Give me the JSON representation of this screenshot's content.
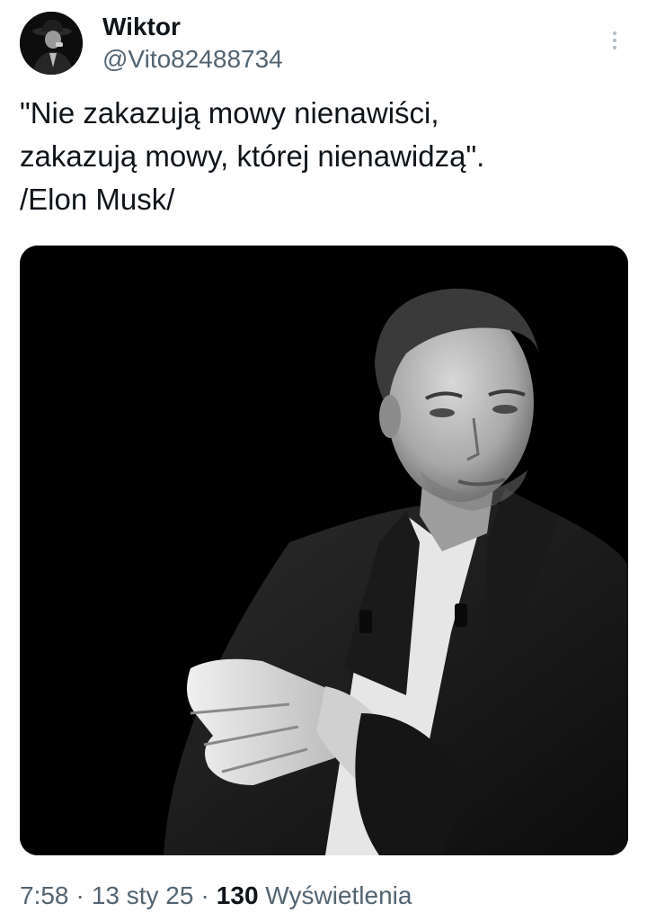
{
  "author": {
    "display_name": "Wiktor",
    "handle": "@Vito82488734",
    "avatar_icon": "avatar-man-in-hat-icon"
  },
  "tweet": {
    "text_lines": [
      "\"Nie zakazują mowy nienawiści,",
      "zakazują mowy, której nienawidzą\".",
      "/Elon Musk/"
    ]
  },
  "media": {
    "kind": "black-and-white portrait photo"
  },
  "meta": {
    "time": "7:58",
    "date": "13 sty 25",
    "separator": "·",
    "views_count": "130",
    "views_label": "Wyświetlenia"
  },
  "colors": {
    "text": "#0f1419",
    "secondary": "#536471",
    "media_background": "#000000"
  }
}
